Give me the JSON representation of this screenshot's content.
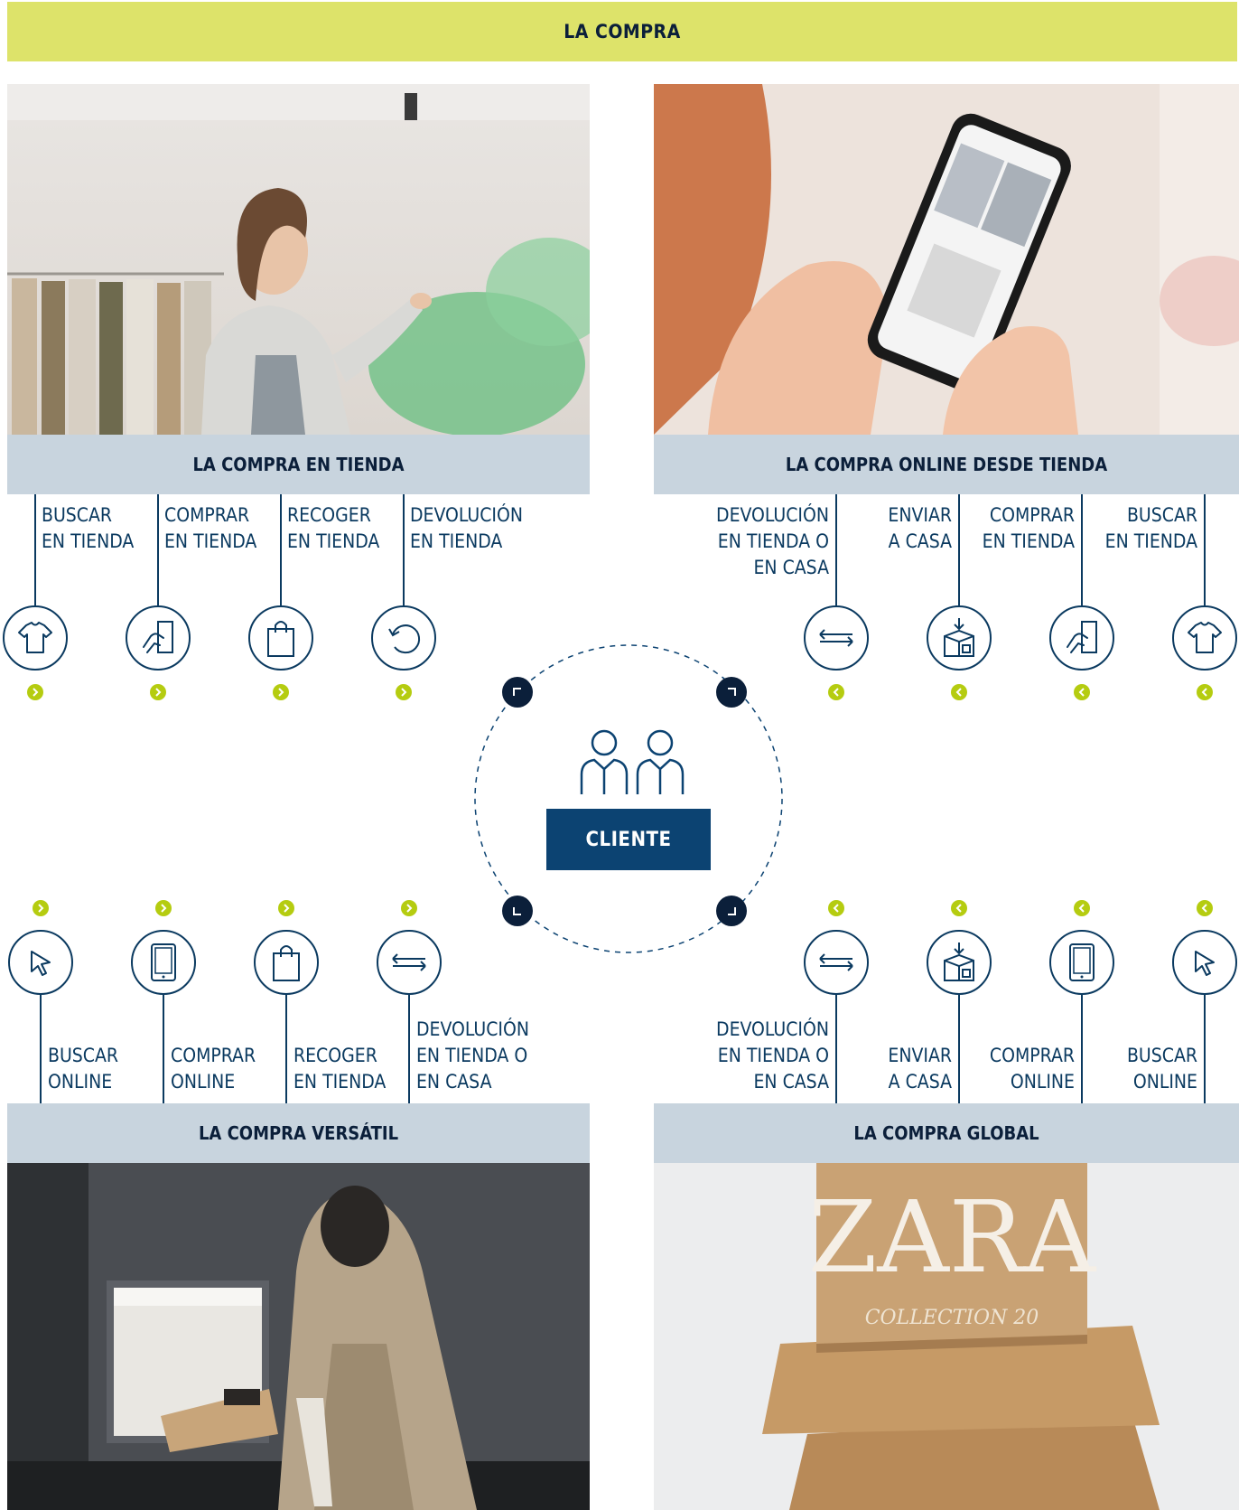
{
  "header": {
    "title": "LA COMPRA"
  },
  "center": {
    "label": "CLIENTE",
    "icon": "people-icon"
  },
  "colors": {
    "banner": "#dde36a",
    "navy": "#0b3a60",
    "label_bar": "#c8d4de",
    "accent_green": "#b5cc10",
    "cliente_bg": "#0c4372"
  },
  "quadrants": {
    "top_left": {
      "title": "LA COMPRA EN TIENDA",
      "photo": "woman browsing clothing rack in store",
      "steps": [
        {
          "label": "BUSCAR\nEN TIENDA",
          "icon": "tshirt-icon"
        },
        {
          "label": "COMPRAR\nEN TIENDA",
          "icon": "hand-card-icon"
        },
        {
          "label": "RECOGER\nEN TIENDA",
          "icon": "shopping-bag-icon"
        },
        {
          "label": "DEVOLUCIÓN\nEN TIENDA",
          "icon": "return-arrow-icon"
        }
      ]
    },
    "top_right": {
      "title": "LA COMPRA ONLINE DESDE TIENDA",
      "photo": "hands holding smartphone showing shopping app",
      "steps": [
        {
          "label": "DEVOLUCIÓN\nEN TIENDA O\nEN CASA",
          "icon": "exchange-arrows-icon"
        },
        {
          "label": "ENVIAR\nA CASA",
          "icon": "delivery-box-icon"
        },
        {
          "label": "COMPRAR\nEN TIENDA",
          "icon": "hand-card-icon"
        },
        {
          "label": "BUSCAR\nEN TIENDA",
          "icon": "tshirt-icon"
        }
      ]
    },
    "bottom_left": {
      "title": "LA COMPRA VERSÁTIL",
      "photo": "woman in trench coat collecting parcel from pickup locker",
      "steps": [
        {
          "label": "BUSCAR\nONLINE",
          "icon": "cursor-icon"
        },
        {
          "label": "COMPRAR\nONLINE",
          "icon": "tablet-icon"
        },
        {
          "label": "RECOGER\nEN TIENDA",
          "icon": "shopping-bag-icon"
        },
        {
          "label": "DEVOLUCIÓN\nEN TIENDA O\nEN CASA",
          "icon": "exchange-arrows-icon"
        }
      ]
    },
    "bottom_right": {
      "title": "LA COMPRA GLOBAL",
      "photo": "stacked cardboard shipping boxes",
      "box_text": {
        "logo": "ZARA",
        "caption": "COLLECTION 20"
      },
      "steps": [
        {
          "label": "DEVOLUCIÓN\nEN TIENDA O\nEN CASA",
          "icon": "exchange-arrows-icon"
        },
        {
          "label": "ENVIAR\nA CASA",
          "icon": "delivery-box-icon"
        },
        {
          "label": "COMPRAR\nONLINE",
          "icon": "tablet-icon"
        },
        {
          "label": "BUSCAR\nONLINE",
          "icon": "cursor-icon"
        }
      ]
    }
  }
}
